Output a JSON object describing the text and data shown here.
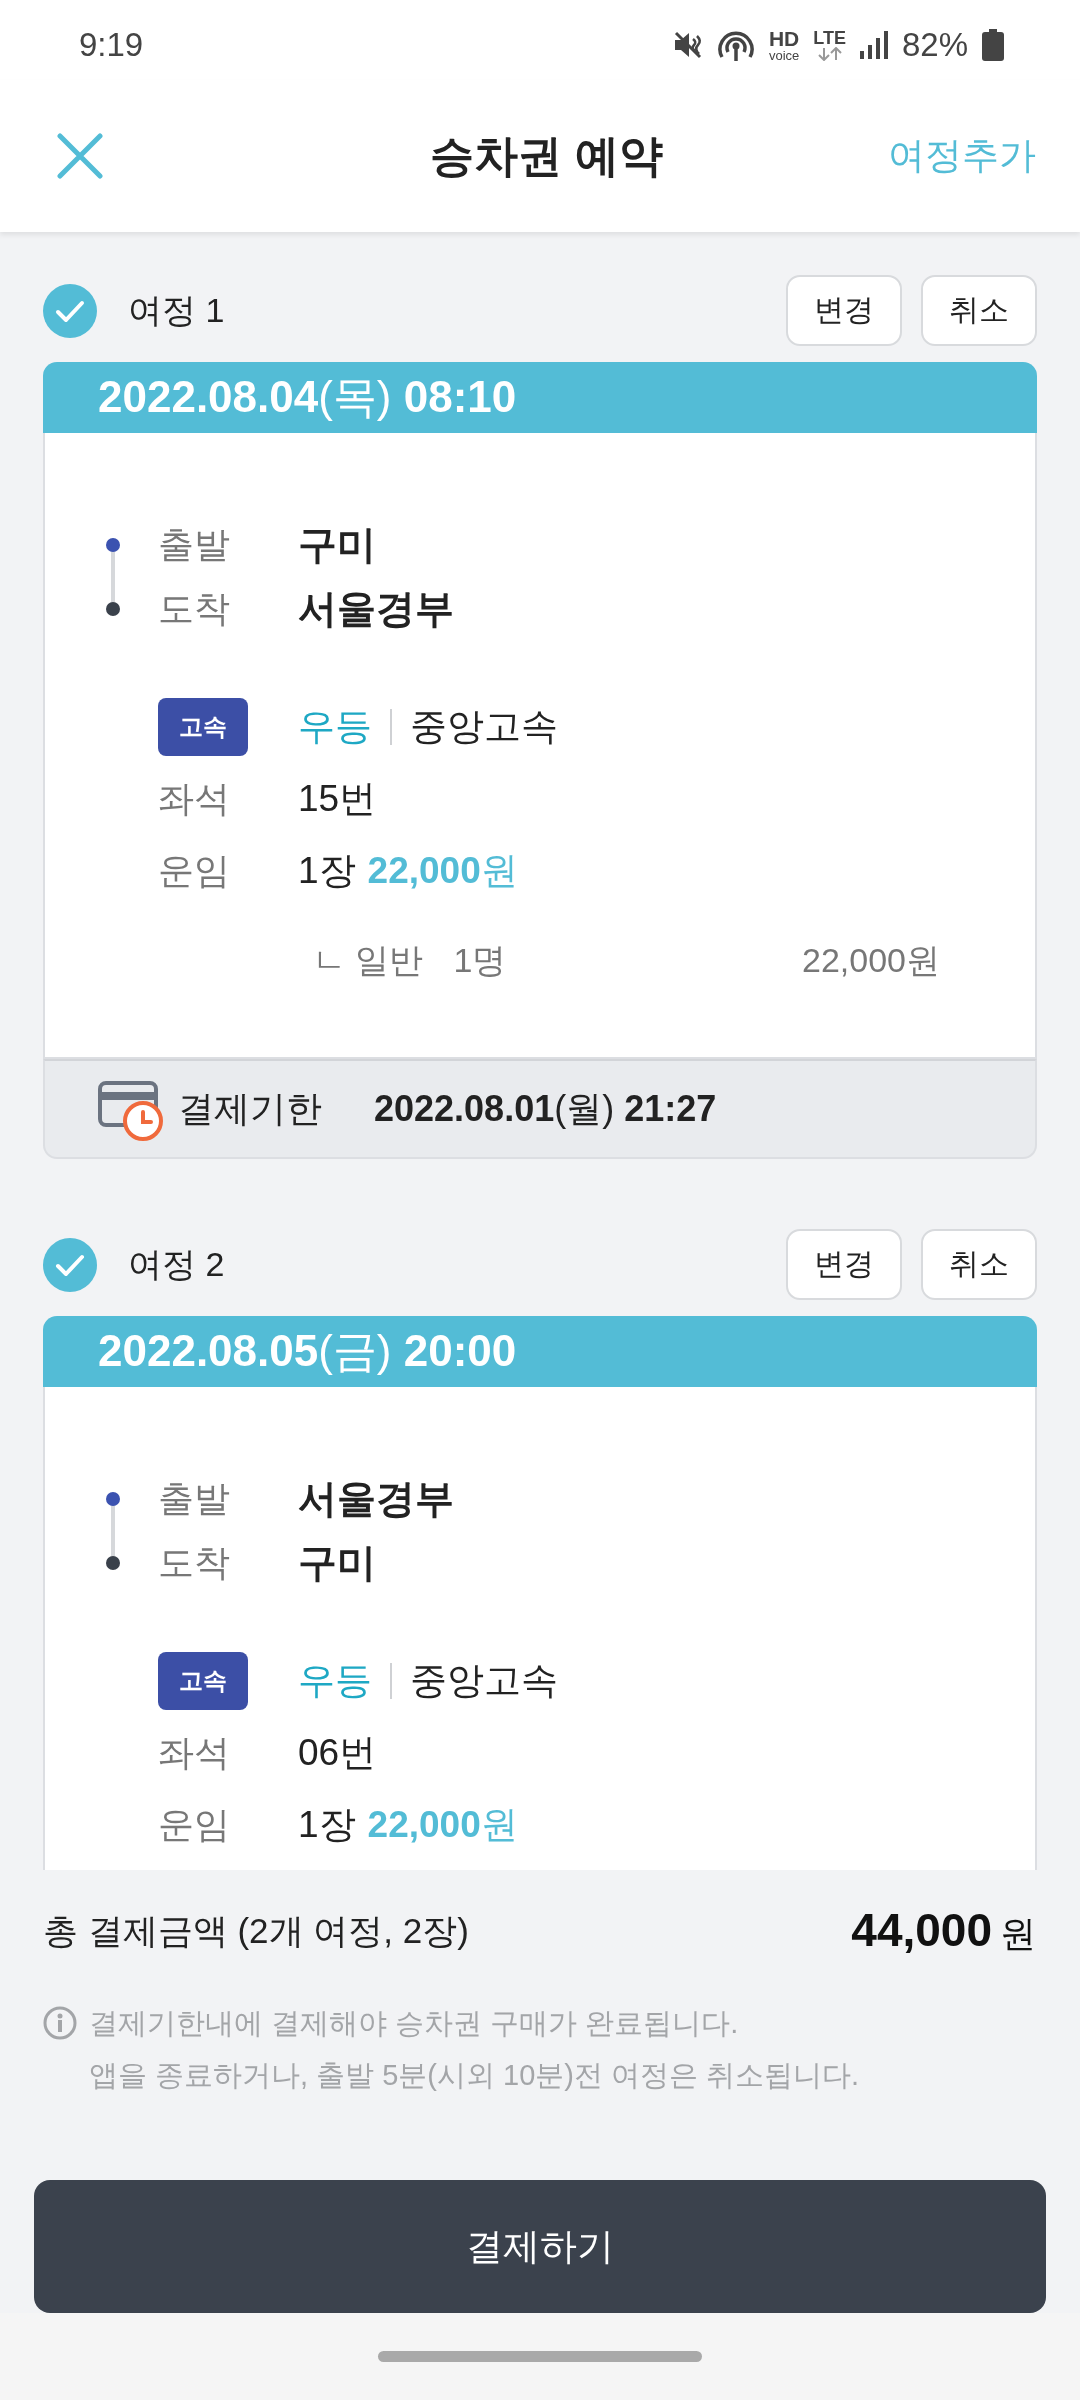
{
  "status_bar": {
    "time": "9:19",
    "hd": "HD",
    "voice": "voice",
    "network": "LTE",
    "battery": "82%"
  },
  "header": {
    "title": "승차권 예약",
    "action": "여정추가"
  },
  "itineraries": [
    {
      "title": "여정 1",
      "checked": true,
      "buttons": [
        "변경",
        "취소"
      ],
      "departure_time": "**2022.08.04**(목) **08:10**",
      "route": [
        {
          "kind": "departure",
          "label": "출발",
          "value": "구미"
        },
        {
          "kind": "arrival",
          "label": "도착",
          "value": "서울경부"
        }
      ],
      "operator": {
        "badge": "고속",
        "grade": "우등",
        "company": "중앙고속"
      },
      "seat": {
        "label": "좌석",
        "value": "15번"
      },
      "fare": {
        "label": "운임",
        "count": "1장",
        "amount": "**22,000**원"
      },
      "breakdown": {
        "type": "ㄴ 일반",
        "count": "1명",
        "amount": "22,000원"
      },
      "deadline": {
        "label": "결제기한",
        "value": "**2022.08.01**(월) **21:27**"
      }
    },
    {
      "title": "여정 2",
      "checked": true,
      "buttons": [
        "변경",
        "취소"
      ],
      "departure_time": "**2022.08.05**(금) **20:00**",
      "route": [
        {
          "kind": "departure",
          "label": "출발",
          "value": "서울경부"
        },
        {
          "kind": "arrival",
          "label": "도착",
          "value": "구미"
        }
      ],
      "operator": {
        "badge": "고속",
        "grade": "우등",
        "company": "중앙고속"
      },
      "seat": {
        "label": "좌석",
        "value": "06번"
      },
      "fare": {
        "label": "운임",
        "count": "1장",
        "amount": "**22,000**원"
      }
    }
  ],
  "total": {
    "label": "총 결제금액 (2개 여정, 2장)",
    "amount": "44,000",
    "unit": "원"
  },
  "notes": [
    "결제기한내에 결제해야 승차권 구매가 완료됩니다.",
    "앱을 종료하거나, 출발 5분(시외 10분)전 여정은 취소됩니다."
  ],
  "pay_button": "결제하기"
}
